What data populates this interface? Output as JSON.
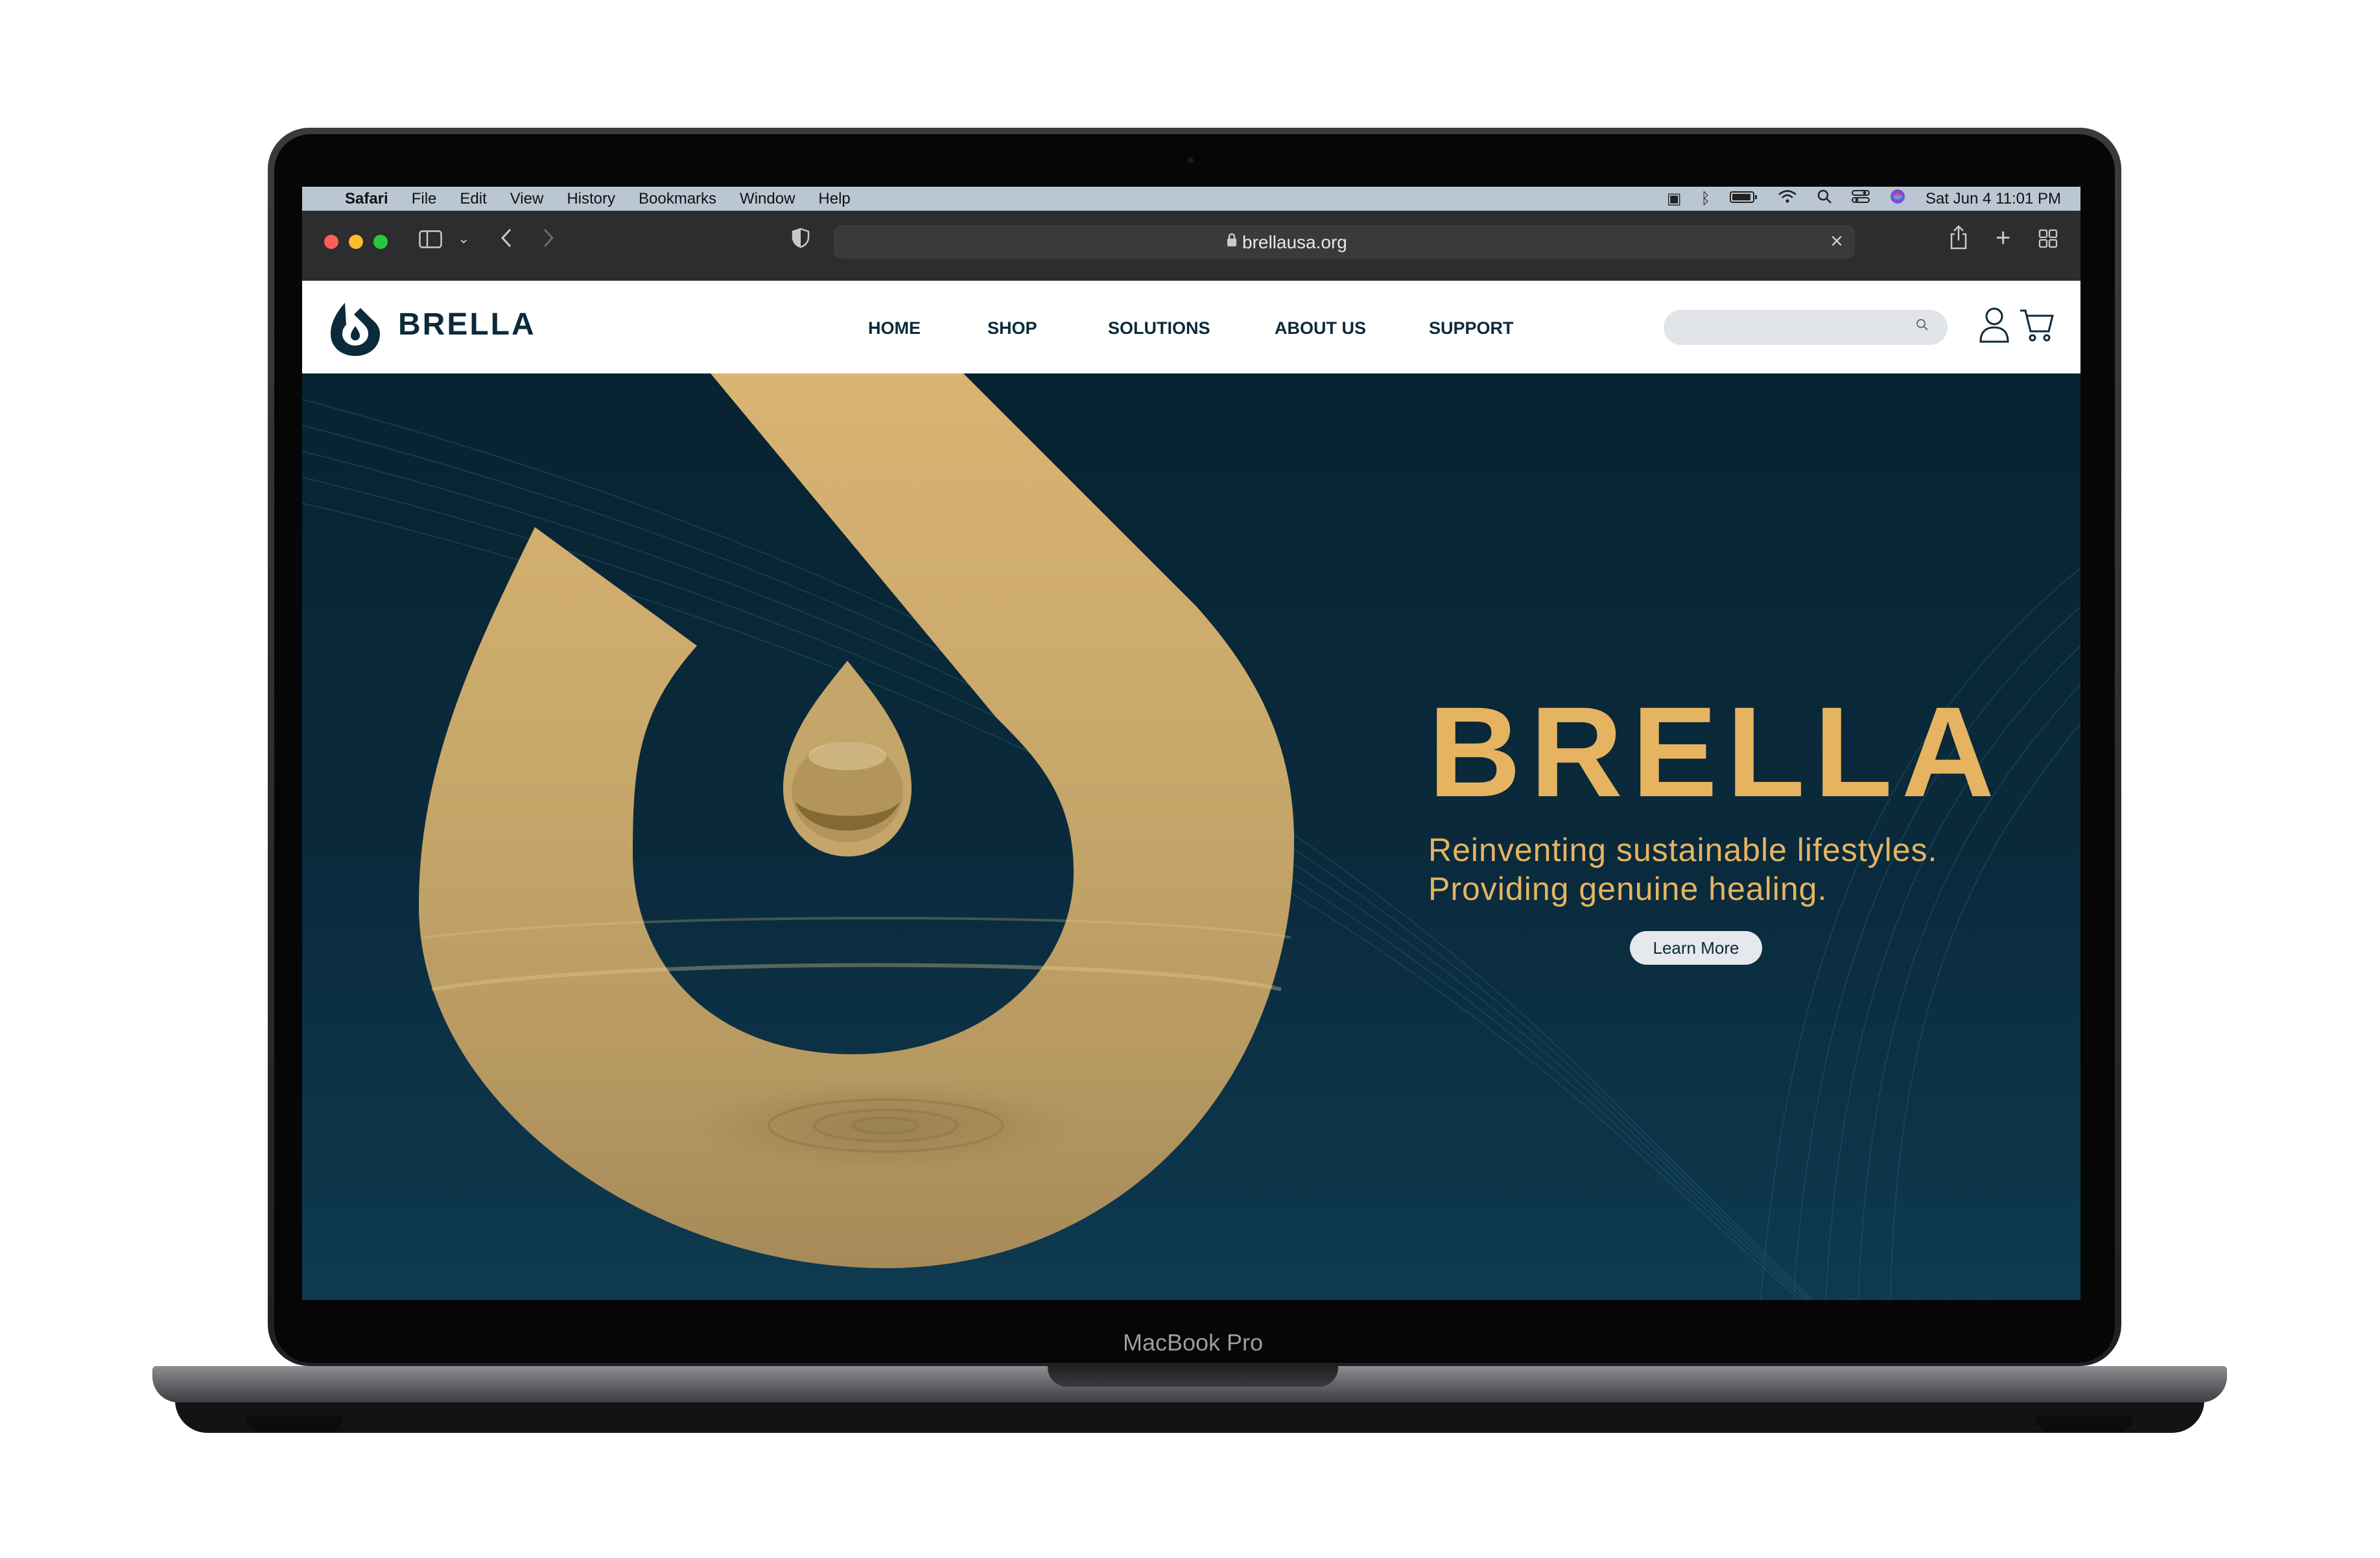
{
  "device": {
    "label": "MacBook Pro"
  },
  "menubar": {
    "app": "Safari",
    "items": [
      "File",
      "Edit",
      "View",
      "History",
      "Bookmarks",
      "Window",
      "Help"
    ],
    "datetime": "Sat Jun 4  11:01 PM"
  },
  "browser": {
    "url": "brellausa.org"
  },
  "site": {
    "brand": "BRELLA",
    "nav": [
      "HOME",
      "SHOP",
      "SOLUTIONS",
      "ABOUT US",
      "SUPPORT"
    ],
    "search_placeholder": ""
  },
  "hero": {
    "title": "BRELLA",
    "subtitle_line1": "Reinventing sustainable lifestyles.",
    "subtitle_line2": "Providing genuine healing.",
    "cta": "Learn More"
  },
  "colors": {
    "accent_gold": "#e6b460",
    "navy": "#0c2a3a",
    "hero_bg": "#0a2b3d"
  }
}
